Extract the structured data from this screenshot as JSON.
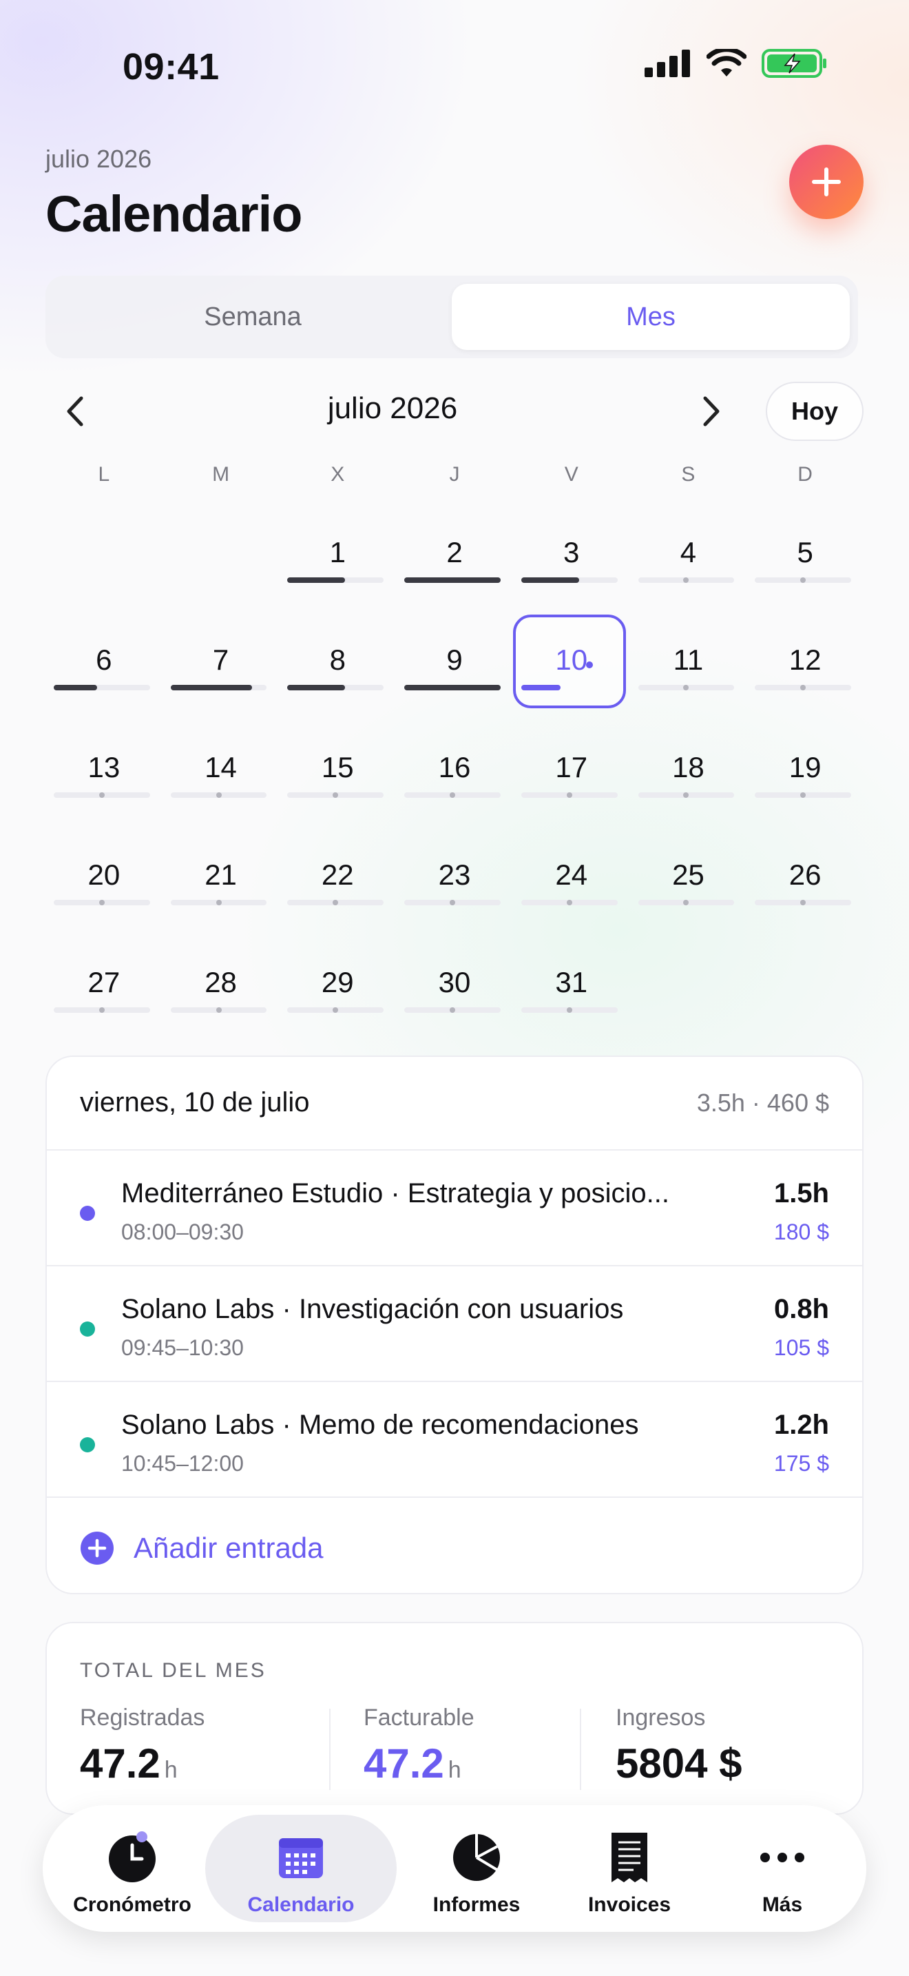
{
  "status_bar": {
    "time": "09:41"
  },
  "header": {
    "subtitle": "julio 2026",
    "title": "Calendario"
  },
  "segmented": {
    "week": "Semana",
    "month": "Mes"
  },
  "month_nav": {
    "title": "julio 2026",
    "today": "Hoy"
  },
  "weekdays": [
    "L",
    "M",
    "X",
    "J",
    "V",
    "S",
    "D"
  ],
  "days": [
    {
      "num": "",
      "fill": 0
    },
    {
      "num": "",
      "fill": 0
    },
    {
      "num": "1",
      "fill": 0.6
    },
    {
      "num": "2",
      "fill": 1.0
    },
    {
      "num": "3",
      "fill": 0.6
    },
    {
      "num": "4",
      "fill": 0
    },
    {
      "num": "5",
      "fill": 0
    },
    {
      "num": "6",
      "fill": 0.45
    },
    {
      "num": "7",
      "fill": 0.85
    },
    {
      "num": "8",
      "fill": 0.6
    },
    {
      "num": "9",
      "fill": 1.0
    },
    {
      "num": "10",
      "fill": 0.45,
      "today": true
    },
    {
      "num": "11",
      "fill": 0
    },
    {
      "num": "12",
      "fill": 0
    },
    {
      "num": "13",
      "fill": 0
    },
    {
      "num": "14",
      "fill": 0
    },
    {
      "num": "15",
      "fill": 0
    },
    {
      "num": "16",
      "fill": 0
    },
    {
      "num": "17",
      "fill": 0
    },
    {
      "num": "18",
      "fill": 0
    },
    {
      "num": "19",
      "fill": 0
    },
    {
      "num": "20",
      "fill": 0
    },
    {
      "num": "21",
      "fill": 0
    },
    {
      "num": "22",
      "fill": 0
    },
    {
      "num": "23",
      "fill": 0
    },
    {
      "num": "24",
      "fill": 0
    },
    {
      "num": "25",
      "fill": 0
    },
    {
      "num": "26",
      "fill": 0
    },
    {
      "num": "27",
      "fill": 0
    },
    {
      "num": "28",
      "fill": 0
    },
    {
      "num": "29",
      "fill": 0
    },
    {
      "num": "30",
      "fill": 0
    },
    {
      "num": "31",
      "fill": 0
    }
  ],
  "day_card": {
    "date": "viernes, 10 de julio",
    "summary": "3.5h · 460 $",
    "entries": [
      {
        "title": "Mediterráneo Estudio · Estrategia y posicio...",
        "time": "08:00–09:30",
        "hours": "1.5h",
        "amount": "180 $",
        "color": "#6a5cf0"
      },
      {
        "title": "Solano Labs · Investigación con usuarios",
        "time": "09:45–10:30",
        "hours": "0.8h",
        "amount": "105 $",
        "color": "#19b39a"
      },
      {
        "title": "Solano Labs · Memo de recomendaciones",
        "time": "10:45–12:00",
        "hours": "1.2h",
        "amount": "175 $",
        "color": "#19b39a"
      }
    ],
    "add_label": "Añadir entrada"
  },
  "totals": {
    "title": "TOTAL DEL MES",
    "registered_label": "Registradas",
    "registered_value": "47.2",
    "billable_label": "Facturable",
    "billable_value": "47.2",
    "income_label": "Ingresos",
    "income_value": "5804 $",
    "unit": "h"
  },
  "tabbar": {
    "tabs": [
      {
        "label": "Cronómetro",
        "icon": "clock-icon"
      },
      {
        "label": "Calendario",
        "icon": "calendar-icon"
      },
      {
        "label": "Informes",
        "icon": "pie-chart-icon"
      },
      {
        "label": "Invoices",
        "icon": "invoice-icon"
      },
      {
        "label": "Más",
        "icon": "more-icon"
      }
    ]
  },
  "colors": {
    "accent": "#6a5cf0",
    "teal": "#19b39a",
    "fab_start": "#f0527a",
    "fab_end": "#ff8a3d"
  }
}
